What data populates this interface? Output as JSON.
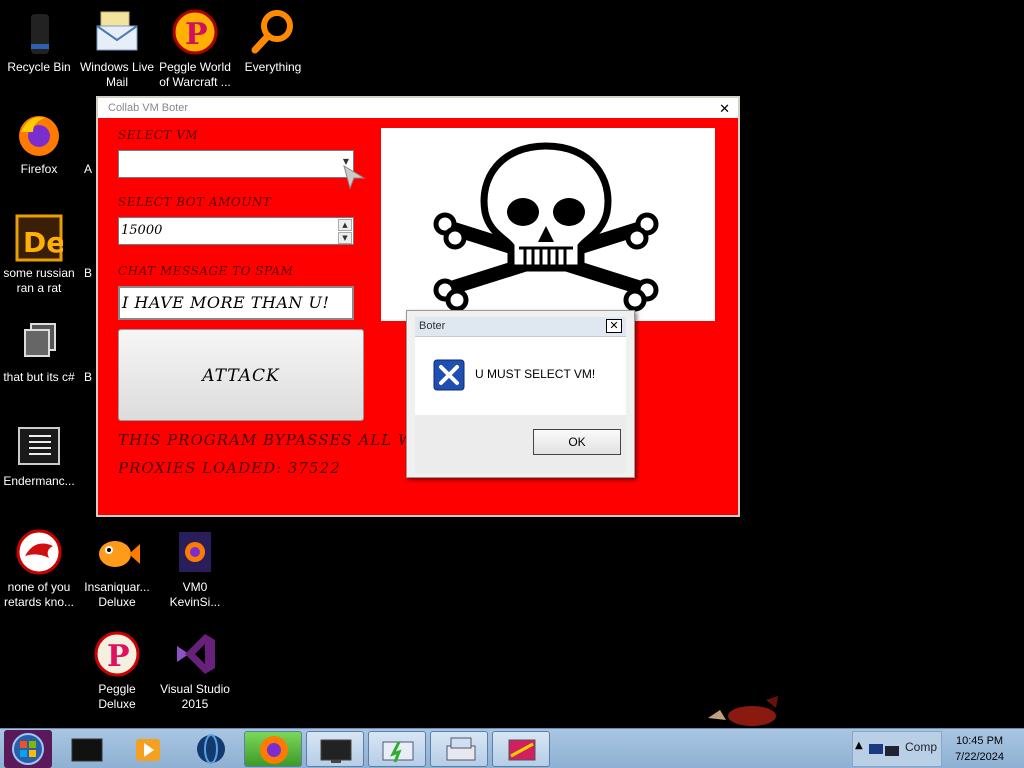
{
  "desktop": {
    "icons": [
      {
        "label": "Recycle Bin",
        "icon": "recycle-bin-icon"
      },
      {
        "label": "Windows Live Mail",
        "icon": "mail-icon"
      },
      {
        "label": "Peggle World of Warcraft ...",
        "icon": "peggle-icon"
      },
      {
        "label": "Everything",
        "icon": "search-icon"
      },
      {
        "label": "Firefox",
        "icon": "firefox-icon"
      },
      {
        "label": "some russian ran a rat",
        "icon": "de-app-icon"
      },
      {
        "label": "that but its c#",
        "icon": "window-stack-icon"
      },
      {
        "label": "Endermanc...",
        "icon": "text-file-icon"
      },
      {
        "label": "none of you retards kno...",
        "icon": "dragon-icon"
      },
      {
        "label": "Insaniquar... Deluxe",
        "icon": "fish-icon"
      },
      {
        "label": "VM0 KevinSi...",
        "icon": "firefox-file-icon"
      },
      {
        "label": "Peggle Deluxe",
        "icon": "peggle-icon"
      },
      {
        "label": "Visual Studio 2015",
        "icon": "visual-studio-icon"
      }
    ],
    "partial_labels": [
      "A",
      "B",
      "B"
    ]
  },
  "app": {
    "title": "Collab VM Boter",
    "select_vm_label": "SELECT VM",
    "select_vm_value": "",
    "bot_amount_label": "SELECT BOT AMOUNT",
    "bot_amount_value": "15000",
    "chat_label": "CHAT MESSAGE TO SPAM",
    "chat_value": "I HAVE MORE THAN U!",
    "attack_label": "ATTACK",
    "bypass_text": "THIS PROGRAM BYPASSES ALL W",
    "proxies_text": "PROXIES LOADED: 37522",
    "image": "skull-crossbones-icon"
  },
  "dialog": {
    "title": "Boter",
    "message": "U MUST SELECT VM!",
    "ok_label": "OK",
    "icon": "error-x-icon"
  },
  "taskbar": {
    "clock_time": "10:45 PM",
    "clock_date": "7/22/2024",
    "tray_text": "Comp",
    "buttons": [
      "start-orb-icon",
      "terminal-icon",
      "media-player-icon",
      "globe-icon",
      "firefox-icon",
      "monitor-icon",
      "network-icon",
      "printer-icon",
      "rainbow-window-icon"
    ]
  },
  "colors": {
    "app_bg": "#ff0000",
    "desktop_bg": "#000000",
    "taskbar": "#9bbbdc"
  }
}
